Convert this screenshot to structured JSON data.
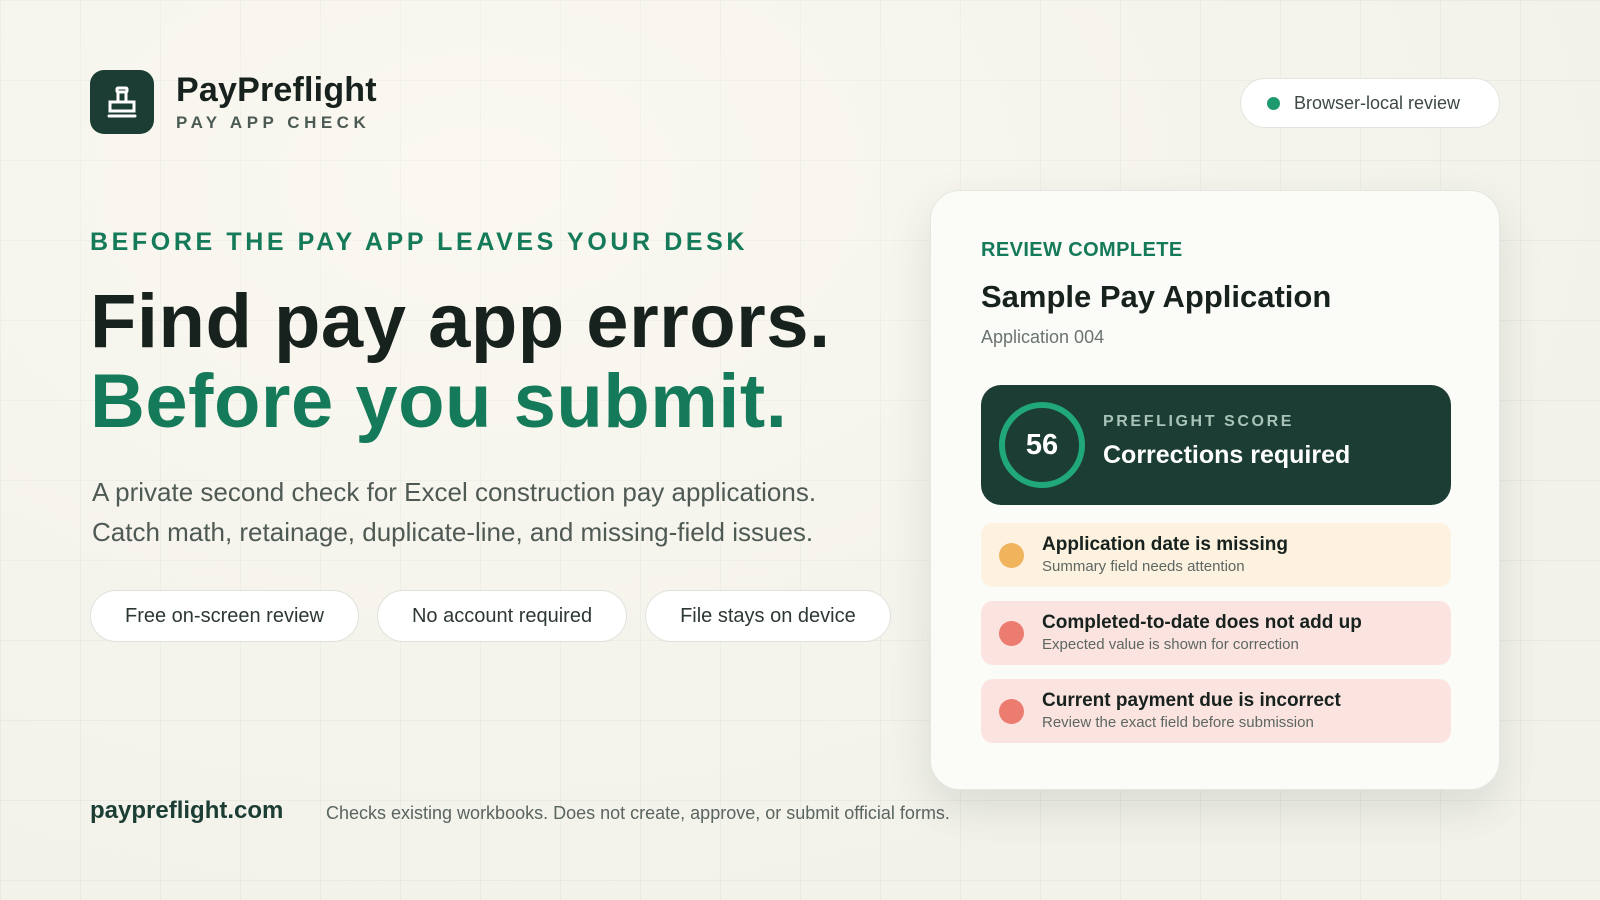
{
  "brand": {
    "name": "PayPreflight",
    "tagline": "PAY APP CHECK",
    "logo_icon": "stamp-icon"
  },
  "status_pill": {
    "label": "Browser-local review",
    "dot_color": "#1f9a6e"
  },
  "hero": {
    "eyebrow": "BEFORE THE PAY APP LEAVES YOUR DESK",
    "headline_line1": "Find pay app errors.",
    "headline_line2": "Before you submit.",
    "subtitle_line1": "A private second check for Excel construction pay applications.",
    "subtitle_line2": "Catch math, retainage, duplicate-line, and missing-field issues."
  },
  "chips": [
    {
      "label": "Free on-screen review"
    },
    {
      "label": "No account required"
    },
    {
      "label": "File stays on device"
    }
  ],
  "card": {
    "eyebrow": "REVIEW COMPLETE",
    "title": "Sample Pay Application",
    "subtitle": "Application 004",
    "score": {
      "value": "56",
      "label": "PREFLIGHT SCORE",
      "status": "Corrections required"
    },
    "issues": [
      {
        "severity": "warning",
        "title": "Application date is missing",
        "description": "Summary field needs attention"
      },
      {
        "severity": "error",
        "title": "Completed-to-date does not add up",
        "description": "Expected value is shown for correction"
      },
      {
        "severity": "error",
        "title": "Current payment due is incorrect",
        "description": "Review the exact field before submission"
      }
    ]
  },
  "footer": {
    "domain": "paypreflight.com",
    "note": "Checks existing workbooks. Does not create, approve, or submit official forms."
  },
  "colors": {
    "brand_dark": "#1b3d34",
    "brand_green": "#157a59",
    "warning": "#f0b45d",
    "error": "#ec7b70"
  }
}
